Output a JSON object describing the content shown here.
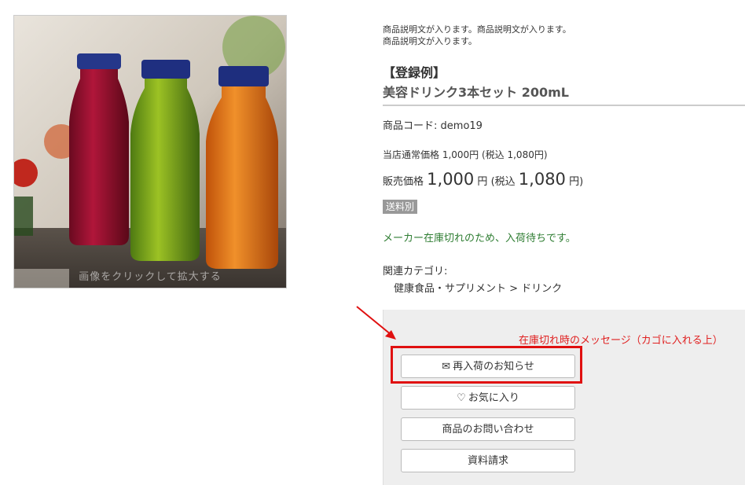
{
  "product": {
    "image_caption": "画像をクリックして拡大する",
    "description_line1": "商品説明文が入ります。商品説明文が入ります。",
    "description_line2": "商品説明文が入ります。",
    "registration_label": "【登録例】",
    "name": "美容ドリンク3本セット 200mL",
    "code_label": "商品コード:",
    "code_value": "demo19",
    "regular_price_text": "当店通常価格 1,000円 (税込 1,080円)",
    "sale_label": "販売価格",
    "sale_price": "1,000",
    "yen": "円",
    "tax_prefix": "(税込",
    "tax_price": "1,080",
    "tax_suffix": "円)",
    "shipping_badge": "送料別",
    "stock_message": "メーカー在庫切れのため、入荷待ちです。",
    "category_label": "関連カテゴリ:",
    "category_path": "健康食品・サプリメント > ドリンク"
  },
  "actions": {
    "annotation_note": "在庫切れ時のメッセージ（カゴに入れる上）",
    "restock_notify": "再入荷のお知らせ",
    "favorite": "お気に入り",
    "inquiry": "商品のお問い合わせ",
    "request_docs": "資料請求",
    "icons": {
      "restock": "mail-icon",
      "favorite": "heart-icon"
    },
    "highlight_color": "#e01010"
  },
  "colors": {
    "stock_text": "#2e7d32",
    "badge_bg": "#999999",
    "action_panel_bg": "#eeeeee"
  }
}
